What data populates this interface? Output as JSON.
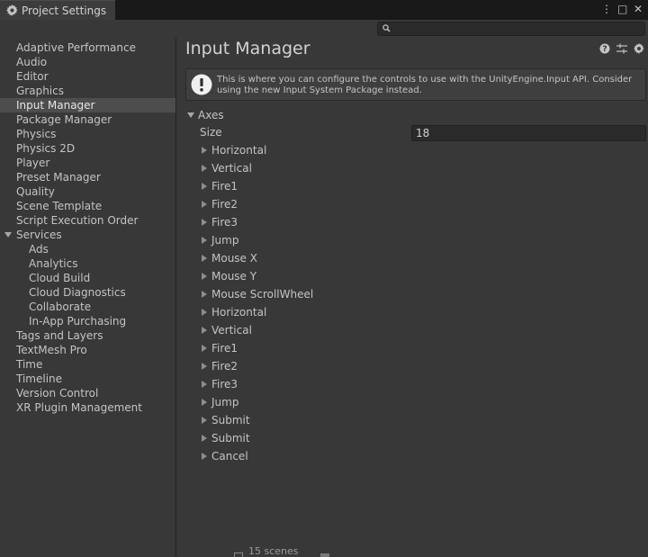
{
  "window": {
    "tab_title": "Project Settings",
    "controls": [
      "⋮",
      "□",
      "✕"
    ]
  },
  "search": {
    "placeholder": ""
  },
  "sidebar": {
    "items": [
      {
        "label": "Adaptive Performance",
        "indent": 0
      },
      {
        "label": "Audio",
        "indent": 0
      },
      {
        "label": "Editor",
        "indent": 0
      },
      {
        "label": "Graphics",
        "indent": 0
      },
      {
        "label": "Input Manager",
        "indent": 0,
        "selected": true
      },
      {
        "label": "Package Manager",
        "indent": 0
      },
      {
        "label": "Physics",
        "indent": 0
      },
      {
        "label": "Physics 2D",
        "indent": 0
      },
      {
        "label": "Player",
        "indent": 0
      },
      {
        "label": "Preset Manager",
        "indent": 0
      },
      {
        "label": "Quality",
        "indent": 0
      },
      {
        "label": "Scene Template",
        "indent": 0
      },
      {
        "label": "Script Execution Order",
        "indent": 0
      },
      {
        "label": "Services",
        "indent": 0,
        "expanded": true
      },
      {
        "label": "Ads",
        "indent": 1
      },
      {
        "label": "Analytics",
        "indent": 1
      },
      {
        "label": "Cloud Build",
        "indent": 1
      },
      {
        "label": "Cloud Diagnostics",
        "indent": 1
      },
      {
        "label": "Collaborate",
        "indent": 1
      },
      {
        "label": "In-App Purchasing",
        "indent": 1
      },
      {
        "label": "Tags and Layers",
        "indent": 0
      },
      {
        "label": "TextMesh Pro",
        "indent": 0
      },
      {
        "label": "Time",
        "indent": 0
      },
      {
        "label": "Timeline",
        "indent": 0
      },
      {
        "label": "Version Control",
        "indent": 0
      },
      {
        "label": "XR Plugin Management",
        "indent": 0
      }
    ]
  },
  "main": {
    "title": "Input Manager",
    "header_icons": [
      "help-icon",
      "preset-icon",
      "settings-icon"
    ],
    "help_message": "This is where you can configure the controls to use with the UnityEngine.Input API. Consider using the new Input System Package instead.",
    "axes_label": "Axes",
    "size_label": "Size",
    "size_value": "18",
    "axes": [
      "Horizontal",
      "Vertical",
      "Fire1",
      "Fire2",
      "Fire3",
      "Jump",
      "Mouse X",
      "Mouse Y",
      "Mouse ScrollWheel",
      "Horizontal",
      "Vertical",
      "Fire1",
      "Fire2",
      "Fire3",
      "Jump",
      "Submit",
      "Submit",
      "Cancel"
    ]
  },
  "bottom": {
    "partial_text": "15 scenes"
  },
  "colors": {
    "background": "#383838",
    "titlebar": "#191919",
    "selected_row": "#4d4d4d",
    "text": "#c4c4c4"
  }
}
